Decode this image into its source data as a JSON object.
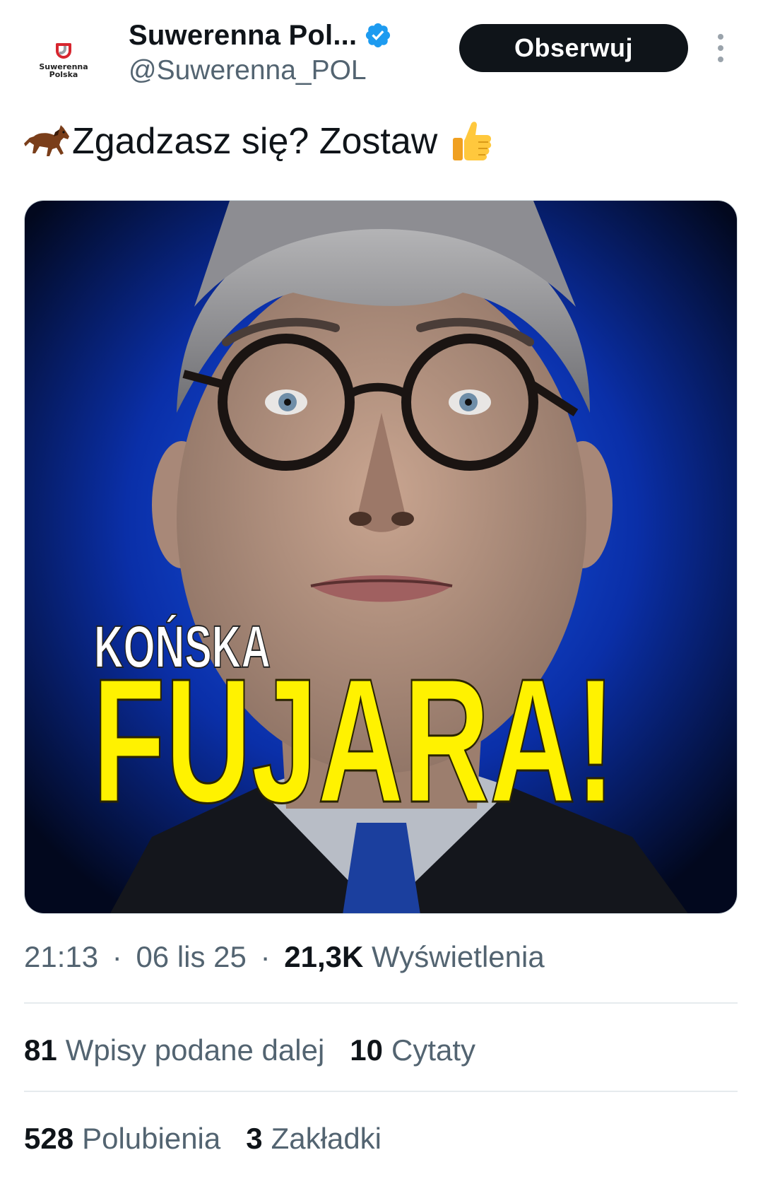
{
  "author": {
    "display_name": "Suwerenna Pol...",
    "handle": "@Suwerenna_POL",
    "avatar_logo_text_line1": "Suwerenna",
    "avatar_logo_text_line2": "Polska",
    "verified": true
  },
  "follow_label": "Obserwuj",
  "tweet": {
    "text": "Zgadzasz się? Zostaw",
    "leading_emoji": "horse-emoji",
    "trailing_emoji": "thumbs-up-emoji"
  },
  "media": {
    "caption_line1": "KOŃSKA",
    "caption_line2": "FUJARA!"
  },
  "meta": {
    "time": "21:13",
    "date": "06 lis 25",
    "views_count": "21,3K",
    "views_label": "Wyświetlenia",
    "separator": "·"
  },
  "stats": {
    "reposts_count": "81",
    "reposts_label": "Wpisy podane dalej",
    "quotes_count": "10",
    "quotes_label": "Cytaty",
    "likes_count": "528",
    "likes_label": "Polubienia",
    "bookmarks_count": "3",
    "bookmarks_label": "Zakładki"
  },
  "colors": {
    "accent_verified": "#1d9bf0",
    "follow_bg": "#0f1419",
    "caption_yellow": "#fff200",
    "muted_text": "#536471"
  }
}
